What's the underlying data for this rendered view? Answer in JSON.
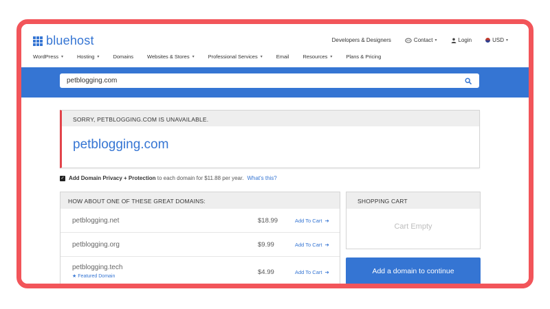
{
  "header": {
    "brand": "bluehost",
    "top_links": {
      "developers": "Developers & Designers",
      "contact": "Contact",
      "login": "Login",
      "currency": "USD"
    },
    "nav": [
      {
        "label": "WordPress",
        "dropdown": true
      },
      {
        "label": "Hosting",
        "dropdown": true
      },
      {
        "label": "Domains",
        "dropdown": false
      },
      {
        "label": "Websites & Stores",
        "dropdown": true
      },
      {
        "label": "Professional Services",
        "dropdown": true
      },
      {
        "label": "Email",
        "dropdown": false
      },
      {
        "label": "Resources",
        "dropdown": true
      },
      {
        "label": "Plans & Pricing",
        "dropdown": false
      }
    ]
  },
  "search": {
    "value": "petblogging.com",
    "icon": "search-icon"
  },
  "unavailable": {
    "message": "SORRY, PETBLOGGING.COM IS UNAVAILABLE.",
    "domain": "petblogging.com"
  },
  "privacy": {
    "checked": true,
    "bold_text": "Add Domain Privacy + Protection",
    "text": "to each domain for $11.88 per year.",
    "link": "What's this?"
  },
  "suggestions": {
    "title": "HOW ABOUT ONE OF THESE GREAT DOMAINS:",
    "add_label": "Add To Cart",
    "rows": [
      {
        "domain": "petblogging.net",
        "price": "$18.99",
        "featured": ""
      },
      {
        "domain": "petblogging.org",
        "price": "$9.99",
        "featured": ""
      },
      {
        "domain": "petblogging.tech",
        "price": "$4.99",
        "featured": "Featured Domain"
      }
    ]
  },
  "cart": {
    "title": "SHOPPING CART",
    "empty": "Cart Empty",
    "cta": "Add a domain to continue"
  },
  "colors": {
    "brand_blue": "#3575d3",
    "frame_red": "#f2555a",
    "error_red": "#e2434a"
  }
}
